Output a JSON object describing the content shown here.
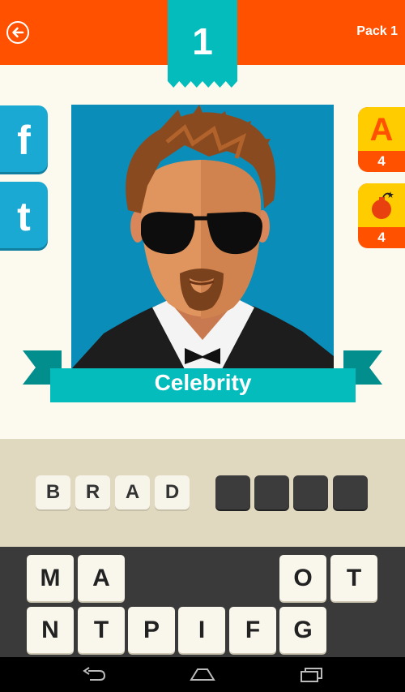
{
  "header": {
    "level": "1",
    "pack": "Pack 1"
  },
  "social": {
    "facebook_label": "f",
    "twitter_label": "t"
  },
  "hints": {
    "reveal_letter": {
      "label": "A",
      "count": "4"
    },
    "bomb": {
      "count": "4"
    }
  },
  "puzzle": {
    "category": "Celebrity"
  },
  "answer": {
    "filled": [
      "B",
      "R",
      "A",
      "D"
    ],
    "empty_count": 4
  },
  "keyboard": {
    "row1": [
      "M",
      "A",
      "",
      "",
      "",
      "O",
      "T"
    ],
    "row2": [
      "N",
      "T",
      "P",
      "I",
      "F",
      "G"
    ]
  },
  "colors": {
    "top_bar": "#ff5100",
    "badge": "#03bcbb",
    "social": "#1aa9d2",
    "hint_yellow": "#ffcc00"
  },
  "icons": [
    "back-arrow-icon",
    "letter-a-icon",
    "bomb-icon",
    "nav-back-icon",
    "nav-home-icon",
    "nav-recent-apps-icon"
  ]
}
